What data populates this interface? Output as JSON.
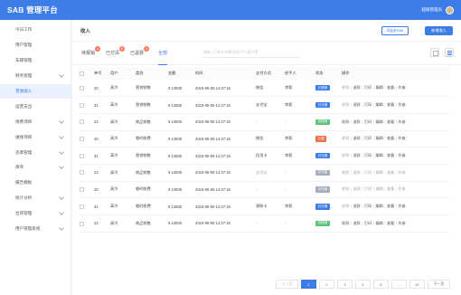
{
  "app": {
    "title": "SAB 管理平台",
    "user_label": "超级管理员"
  },
  "sidebar": {
    "items": [
      {
        "label": "今日工作",
        "has_chevron": false,
        "active": false
      },
      {
        "label": "用户管理",
        "has_chevron": false,
        "active": false
      },
      {
        "label": "车辆管理",
        "has_chevron": false,
        "active": false
      },
      {
        "label": "财务管理",
        "has_chevron": true,
        "active": false
      },
      {
        "label": "营收收入",
        "has_chevron": false,
        "active": true
      },
      {
        "label": "运营支出",
        "has_chevron": false,
        "active": false
      },
      {
        "label": "保费项目",
        "has_chevron": true,
        "active": false
      },
      {
        "label": "维保项目",
        "has_chevron": true,
        "active": false
      },
      {
        "label": "违章管理",
        "has_chevron": true,
        "active": false
      },
      {
        "label": "库存",
        "has_chevron": true,
        "active": false
      },
      {
        "label": "报告模板",
        "has_chevron": false,
        "active": false
      },
      {
        "label": "统计分析",
        "has_chevron": true,
        "active": false
      },
      {
        "label": "合同管理",
        "has_chevron": true,
        "active": false
      },
      {
        "label": "用户管理系统",
        "has_chevron": true,
        "active": false
      }
    ]
  },
  "page": {
    "title": "收入",
    "export_label": "导出Excel",
    "add_label": "新增收入"
  },
  "tabs": [
    {
      "label": "待报销",
      "badge": "4",
      "active": false
    },
    {
      "label": "已付清",
      "badge": "8",
      "active": false
    },
    {
      "label": "已退费",
      "badge": "4",
      "active": false
    },
    {
      "label": "全部",
      "badge": "",
      "active": true
    }
  ],
  "search": {
    "placeholder": "请输入订单号/车牌号/经手人/客户等"
  },
  "table": {
    "headers": [
      "",
      "单号",
      "用户",
      "类别",
      "金额",
      "时间",
      "支付方式",
      "经手人",
      "状态",
      "操作"
    ],
    "rows": [
      {
        "id": "20",
        "user": "高冷",
        "category": "营销销售",
        "amount": "¥ 13500",
        "time": "2019-05-06 14:37:15",
        "pay": "微信",
        "handler": "李毅",
        "status": "已报销",
        "status_color": "#3d7de8",
        "ops": [
          "收款",
          "退款",
          "打印",
          "编辑",
          "查看",
          "作废"
        ],
        "ops_muted": 1
      },
      {
        "id": "21",
        "user": "高冷",
        "category": "营销销售",
        "amount": "¥ 13500",
        "time": "2019-05-06 14:37:15",
        "pay": "支付宝",
        "handler": "李毅",
        "status": "已付清",
        "status_color": "#3d7de8",
        "ops": [
          "收款",
          "退款",
          "打印",
          "编辑",
          "查看",
          "作废"
        ],
        "ops_muted": 1
      },
      {
        "id": "22",
        "user": "高冷",
        "category": "商品销售",
        "amount": "¥ 13500",
        "time": "2019-05-06 14:37:15",
        "pay": "--",
        "handler": "--",
        "status": "待报销",
        "status_color": "#5bc27a",
        "ops": [
          "收款",
          "退款",
          "打印",
          "编辑",
          "查看",
          "作废"
        ],
        "ops_muted": 0
      },
      {
        "id": "20",
        "user": "高冷",
        "category": "临时收费",
        "amount": "¥ 13500",
        "time": "2019-05-06 14:37:15",
        "pay": "微信",
        "handler": "李毅",
        "status": "已退",
        "status_color": "#f0704e",
        "ops": [
          "收款",
          "退款",
          "打印",
          "编辑",
          "查看",
          "作废"
        ],
        "ops_muted": 1
      },
      {
        "id": "21",
        "user": "高冷",
        "category": "营销销售",
        "amount": "¥ 13500",
        "time": "2019-05-06 14:37:15",
        "pay": "信用卡",
        "handler": "李毅",
        "status": "已付清",
        "status_color": "#3d7de8",
        "ops": [
          "收款",
          "退款",
          "打印",
          "编辑",
          "查看",
          "作废"
        ],
        "ops_muted": 1
      },
      {
        "id": "22",
        "user": "高冷",
        "category": "商品销售",
        "amount": "¥ 13500",
        "time": "2019-05-06 14:37:15",
        "pay": "支付宝",
        "handler": "--",
        "status": "已作废",
        "status_color": "#a5adb8",
        "ops": [
          "收款",
          "退款",
          "打印",
          "编辑",
          "查看",
          "作废"
        ],
        "ops_muted": 6
      },
      {
        "id": "20",
        "user": "高冷",
        "category": "临时收费",
        "amount": "¥ 13500",
        "time": "2019-05-06 14:37:15",
        "pay": "--",
        "handler": "--",
        "status": "已作废",
        "status_color": "#a5adb8",
        "ops": [
          "收款",
          "退款",
          "打印",
          "编辑",
          "查看",
          "作废"
        ],
        "ops_muted": 6
      },
      {
        "id": "21",
        "user": "高冷",
        "category": "临时收费",
        "amount": "¥ 13500",
        "time": "2019-05-06 14:37:15",
        "pay": "银联卡",
        "handler": "李毅",
        "status": "已付清",
        "status_color": "#3d7de8",
        "ops": [
          "收款",
          "退款",
          "打印",
          "编辑",
          "查看",
          "作废"
        ],
        "ops_muted": 1
      },
      {
        "id": "22",
        "user": "高冷",
        "category": "商品销售",
        "amount": "¥ 13500",
        "time": "2019-05-06 14:37:15",
        "pay": "--",
        "handler": "--",
        "status": "待报销",
        "status_color": "#5bc27a",
        "ops": [
          "收款",
          "退款",
          "打印",
          "编辑",
          "查看",
          "作废"
        ],
        "ops_muted": 0
      }
    ]
  },
  "pagination": {
    "prev": "上一页",
    "pages": [
      "1",
      "2",
      "3",
      "4",
      "5",
      "...",
      "10"
    ],
    "active": "1",
    "next": "下一页"
  }
}
